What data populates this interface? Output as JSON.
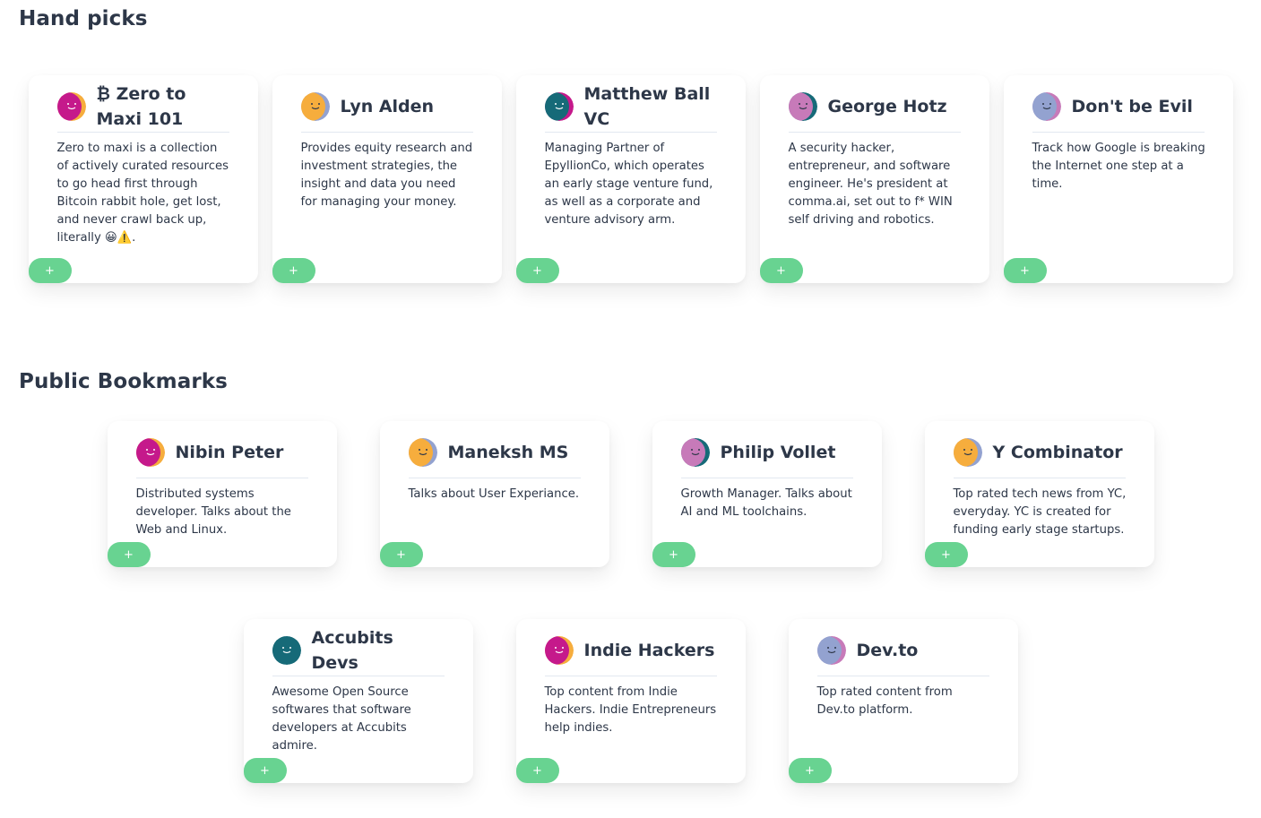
{
  "sections": [
    {
      "title": "Hand picks",
      "cards": [
        {
          "title": "₿ Zero to Maxi 101",
          "desc": "Zero to maxi is a collection of actively curated resources to go head first through Bitcoin rabbit hole, get lost, and never crawl back up, literally 😀⚠️.",
          "avatar": {
            "bg": "#f6ad3d",
            "fg": "#c5198b",
            "face": "#ffffff"
          },
          "add": "+"
        },
        {
          "title": "Lyn Alden",
          "desc": "Provides equity research and investment strategies, the insight and data you need for managing your money.",
          "avatar": {
            "bg": "#93a2d0",
            "fg": "#f6ad3d",
            "face": "#2d3748"
          },
          "add": "+"
        },
        {
          "title": "Matthew Ball VC",
          "desc": "Managing Partner of EpyllionCo, which operates an early stage venture fund, as well as a corporate and venture advisory arm.",
          "avatar": {
            "bg": "#c5198b",
            "fg": "#166a78",
            "face": "#ffffff"
          },
          "add": "+"
        },
        {
          "title": "George Hotz",
          "desc": "A security hacker, entrepreneur, and software engineer. He's president at comma.ai, set out to f* WIN self driving and robotics.",
          "avatar": {
            "bg": "#166a78",
            "fg": "#c77ab9",
            "face": "#2d3748"
          },
          "add": "+"
        },
        {
          "title": "Don't be Evil",
          "desc": "Track how Google is breaking the Internet one step at a time.",
          "avatar": {
            "bg": "#c77ab9",
            "fg": "#93a2d0",
            "face": "#2d3748"
          },
          "add": "+"
        }
      ]
    },
    {
      "title": "Public Bookmarks",
      "cards": [
        {
          "title": "Nibin Peter",
          "desc": "Distributed systems developer. Talks about the Web and Linux.",
          "avatar": {
            "bg": "#f6ad3d",
            "fg": "#c5198b",
            "face": "#ffffff"
          },
          "add": "+"
        },
        {
          "title": "Maneksh MS",
          "desc": "Talks about User Experiance.",
          "avatar": {
            "bg": "#93a2d0",
            "fg": "#f6ad3d",
            "face": "#2d3748"
          },
          "add": "+"
        },
        {
          "title": "Philip Vollet",
          "desc": "Growth Manager. Talks about AI and ML toolchains.",
          "avatar": {
            "bg": "#166a78",
            "fg": "#c77ab9",
            "face": "#2d3748"
          },
          "add": "+"
        },
        {
          "title": "Y Combinator",
          "desc": "Top rated tech news from YC, everyday. YC is created for funding early stage startups.",
          "avatar": {
            "bg": "#93a2d0",
            "fg": "#f6ad3d",
            "face": "#2d3748"
          },
          "add": "+"
        },
        {
          "title": "Accubits Devs",
          "desc": "Awesome Open Source softwares that software developers at Accubits admire.",
          "avatar": {
            "bg": "#166a78",
            "fg": "#166a78",
            "face": "#ffffff"
          },
          "add": "+"
        },
        {
          "title": "Indie Hackers",
          "desc": "Top content from Indie Hackers. Indie Entrepreneurs help indies.",
          "avatar": {
            "bg": "#f6ad3d",
            "fg": "#c5198b",
            "face": "#ffffff"
          },
          "add": "+"
        },
        {
          "title": "Dev.to",
          "desc": "Top rated content from Dev.to platform.",
          "avatar": {
            "bg": "#c77ab9",
            "fg": "#93a2d0",
            "face": "#2d3748"
          },
          "add": "+"
        }
      ]
    }
  ]
}
